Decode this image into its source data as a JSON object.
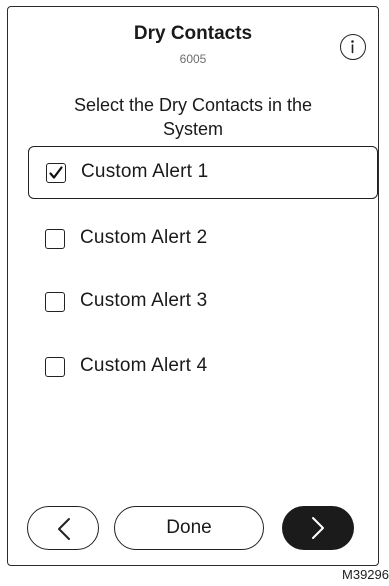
{
  "header": {
    "title": "Dry Contacts",
    "code": "6005",
    "info_icon": "info-circle-icon"
  },
  "instruction": "Select the Dry Contacts in the System",
  "options": [
    {
      "label": "Custom Alert 1",
      "checked": true
    },
    {
      "label": "Custom Alert 2",
      "checked": false
    },
    {
      "label": "Custom Alert 3",
      "checked": false
    },
    {
      "label": "Custom Alert 4",
      "checked": false
    }
  ],
  "footer": {
    "back_icon": "chevron-left-icon",
    "done_label": "Done",
    "next_icon": "chevron-right-icon"
  },
  "figure_id": "M39296"
}
